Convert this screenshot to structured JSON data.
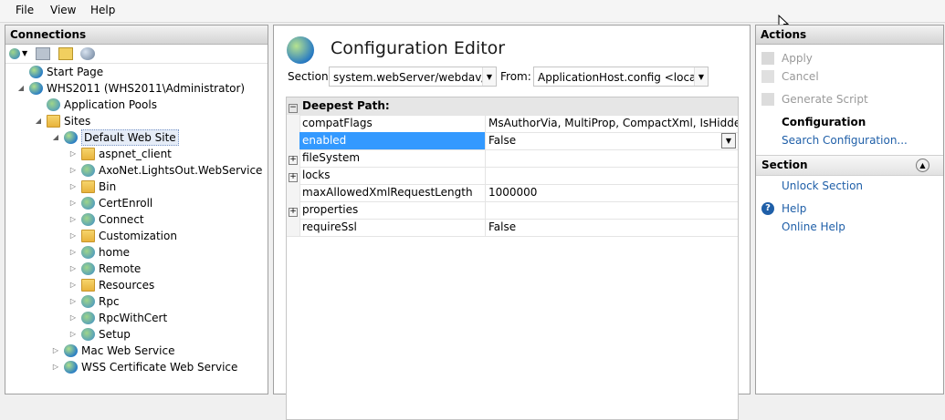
{
  "menu": [
    "File",
    "View",
    "Help"
  ],
  "connections": {
    "header": "Connections",
    "tree": [
      {
        "label": "Start Page",
        "indent": 0,
        "icon": "start-page-icon"
      },
      {
        "label": "WHS2011 (WHS2011\\Administrator)",
        "indent": 0,
        "icon": "server-icon"
      },
      {
        "label": "Application Pools",
        "indent": 1,
        "icon": "app-pools-icon"
      },
      {
        "label": "Sites",
        "indent": 1,
        "icon": "sites-icon"
      },
      {
        "label": "Default Web Site",
        "indent": 2,
        "icon": "website-globe-icon"
      },
      {
        "label": "aspnet_client",
        "indent": 3,
        "icon": "folder-icon"
      },
      {
        "label": "AxoNet.LightsOut.WebService",
        "indent": 3,
        "icon": "application-icon"
      },
      {
        "label": "Bin",
        "indent": 3,
        "icon": "folder-icon"
      },
      {
        "label": "CertEnroll",
        "indent": 3,
        "icon": "application-icon"
      },
      {
        "label": "Connect",
        "indent": 3,
        "icon": "application-icon"
      },
      {
        "label": "Customization",
        "indent": 3,
        "icon": "folder-icon"
      },
      {
        "label": "home",
        "indent": 3,
        "icon": "application-icon"
      },
      {
        "label": "Remote",
        "indent": 3,
        "icon": "application-icon"
      },
      {
        "label": "Resources",
        "indent": 3,
        "icon": "folder-icon"
      },
      {
        "label": "Rpc",
        "indent": 3,
        "icon": "application-icon"
      },
      {
        "label": "RpcWithCert",
        "indent": 3,
        "icon": "application-icon"
      },
      {
        "label": "Setup",
        "indent": 3,
        "icon": "application-icon"
      },
      {
        "label": "Mac Web Service",
        "indent": 2,
        "icon": "website-globe-icon"
      },
      {
        "label": "WSS Certificate Web Service",
        "indent": 2,
        "icon": "website-globe-icon"
      }
    ]
  },
  "editor": {
    "title": "Configuration Editor",
    "section_label": "Section:",
    "section_value": "system.webServer/webdav/aut",
    "from_label": "From:",
    "from_value": "ApplicationHost.config <locat",
    "group_header": "Deepest Path:",
    "rows": [
      {
        "name": "compatFlags",
        "value": "MsAuthorVia, MultiProp, CompactXml, IsHidden, Is",
        "expandable": false
      },
      {
        "name": "enabled",
        "value": "False",
        "expandable": false,
        "selected": true
      },
      {
        "name": "fileSystem",
        "value": "",
        "expandable": true
      },
      {
        "name": "locks",
        "value": "",
        "expandable": true
      },
      {
        "name": "maxAllowedXmlRequestLength",
        "value": "1000000",
        "expandable": false
      },
      {
        "name": "properties",
        "value": "",
        "expandable": true
      },
      {
        "name": "requireSsl",
        "value": "False",
        "expandable": false
      }
    ]
  },
  "actions": {
    "header": "Actions",
    "apply": "Apply",
    "cancel": "Cancel",
    "generate_script": "Generate Script",
    "configuration_heading": "Configuration",
    "search_configuration": "Search Configuration...",
    "section_heading": "Section",
    "unlock_section": "Unlock Section",
    "help": "Help",
    "online_help": "Online Help"
  },
  "colors": {
    "selection_blue": "#3399ff",
    "link_blue": "#1f5fa8",
    "header_gray": "#d4d4d4"
  }
}
